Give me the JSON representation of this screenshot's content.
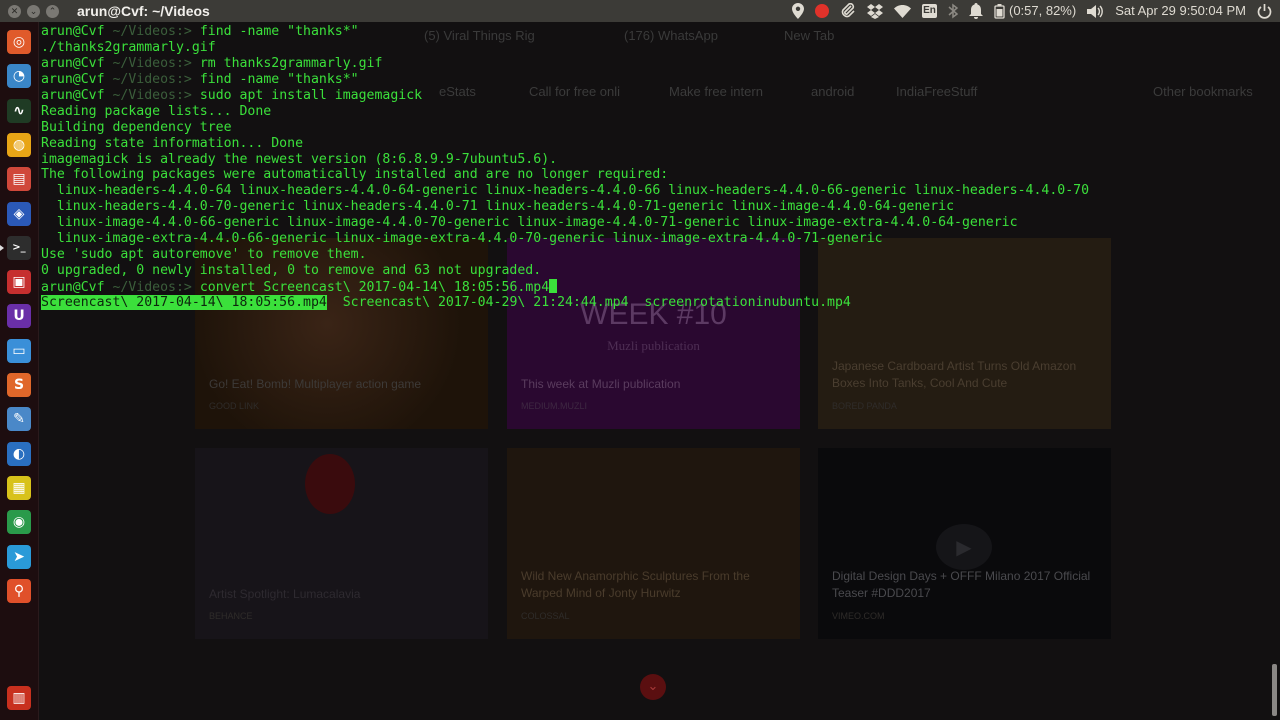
{
  "topbar": {
    "window_title": "arun@Cvf: ~/Videos",
    "battery": "(0:57, 82%)",
    "keyboard": "En",
    "datetime": "Sat Apr 29  9:50:04 PM"
  },
  "launcher": {
    "items": [
      {
        "icon": "ubuntu-dash-icon",
        "color": "#e05a2b",
        "glyph": "◎"
      },
      {
        "icon": "system-monitor-icon",
        "color": "#3a86c8",
        "glyph": "◔"
      },
      {
        "icon": "activity-monitor-icon",
        "color": "#1f3b24",
        "glyph": "∿"
      },
      {
        "icon": "idea-bulb-icon",
        "color": "#e8a516",
        "glyph": "◍"
      },
      {
        "icon": "file-manager-icon",
        "color": "#d0483a",
        "glyph": "▤"
      },
      {
        "icon": "visual-studio-code-icon",
        "color": "#2b59b8",
        "glyph": "◈"
      },
      {
        "icon": "terminal-icon",
        "color": "#2d2d2d",
        "glyph": ">_"
      },
      {
        "icon": "screen-recorder-icon",
        "color": "#c62f2f",
        "glyph": "▣"
      },
      {
        "icon": "upwork-icon",
        "color": "#6a2fa8",
        "glyph": "U"
      },
      {
        "icon": "files-icon",
        "color": "#3a8fd8",
        "glyph": "▭"
      },
      {
        "icon": "sublime-text-icon",
        "color": "#e0672a",
        "glyph": "S"
      },
      {
        "icon": "color-picker-icon",
        "color": "#4a88c8",
        "glyph": "✎"
      },
      {
        "icon": "firefox-icon",
        "color": "#2a6fc0",
        "glyph": "◐"
      },
      {
        "icon": "ruler-icon",
        "color": "#d8c21a",
        "glyph": "▦"
      },
      {
        "icon": "chrome-icon",
        "color": "#2a9a4a",
        "glyph": "◉"
      },
      {
        "icon": "telegram-icon",
        "color": "#2a9ad8",
        "glyph": "➤"
      },
      {
        "icon": "postman-icon",
        "color": "#e0502a",
        "glyph": "⚲"
      },
      {
        "icon": "trash-icon",
        "color": "#c8301e",
        "glyph": "▥"
      }
    ]
  },
  "browser": {
    "tabs": [
      "(5) Viral Things Rig",
      "(176) WhatsApp",
      "New Tab"
    ],
    "bookmarks": [
      "eStats",
      "Call for free onli",
      "Make free intern",
      "android",
      "IndiaFreeStuff",
      "Other bookmarks"
    ],
    "cards": [
      {
        "title": "Go! Eat! Bomb! Multiplayer action game",
        "source": "GOOD LINK"
      },
      {
        "title": "This week at Muzli publication",
        "source": "MEDIUM.MUZLI"
      },
      {
        "title": "Japanese Cardboard Artist Turns Old Amazon Boxes Into Tanks, Cool And Cute",
        "source": "BORED PANDA"
      },
      {
        "title": "Artist Spotlight: Lumacalavia",
        "source": "BEHANCE"
      },
      {
        "title": "Wild New Anamorphic Sculptures From the Warped Mind of Jonty Hurwitz",
        "source": "COLOSSAL"
      },
      {
        "title": "Digital Design Days + OFFF Milano 2017 Official Teaser #DDD2017",
        "source": "VIMEO.COM"
      }
    ],
    "banner_text": "WEEK #10",
    "banner_sub": "Muzli publication"
  },
  "terminal": {
    "prompt_user": "arun@Cvf",
    "prompt_path": " ~/Videos:> ",
    "lines": [
      {
        "type": "prompt",
        "cmd": "find -name \"thanks*\""
      },
      {
        "type": "out",
        "text": "./thanks2grammarly.gif"
      },
      {
        "type": "prompt",
        "cmd": "rm thanks2grammarly.gif"
      },
      {
        "type": "prompt",
        "cmd": "find -name \"thanks*\""
      },
      {
        "type": "prompt",
        "cmd": "sudo apt install imagemagick"
      },
      {
        "type": "out",
        "text": "Reading package lists... Done"
      },
      {
        "type": "out",
        "text": "Building dependency tree"
      },
      {
        "type": "out",
        "text": "Reading state information... Done"
      },
      {
        "type": "out",
        "text": "imagemagick is already the newest version (8:6.8.9.9-7ubuntu5.6)."
      },
      {
        "type": "out",
        "text": "The following packages were automatically installed and are no longer required:"
      },
      {
        "type": "out",
        "text": "  linux-headers-4.4.0-64 linux-headers-4.4.0-64-generic linux-headers-4.4.0-66 linux-headers-4.4.0-66-generic linux-headers-4.4.0-70"
      },
      {
        "type": "out",
        "text": "  linux-headers-4.4.0-70-generic linux-headers-4.4.0-71 linux-headers-4.4.0-71-generic linux-image-4.4.0-64-generic"
      },
      {
        "type": "out",
        "text": "  linux-image-4.4.0-66-generic linux-image-4.4.0-70-generic linux-image-4.4.0-71-generic linux-image-extra-4.4.0-64-generic"
      },
      {
        "type": "out",
        "text": "  linux-image-extra-4.4.0-66-generic linux-image-extra-4.4.0-70-generic linux-image-extra-4.4.0-71-generic"
      },
      {
        "type": "out",
        "text": "Use 'sudo apt autoremove' to remove them."
      },
      {
        "type": "out",
        "text": "0 upgraded, 0 newly installed, 0 to remove and 63 not upgraded."
      },
      {
        "type": "prompt",
        "cmd": "convert Screencast\\ 2017-04-14\\ 18:05:56.mp4",
        "cursor": true
      }
    ],
    "completions": {
      "selected": "Screencast\\ 2017-04-14\\ 18:05:56.mp4",
      "others": [
        "Screencast\\ 2017-04-29\\ 21:24:44.mp4",
        "screenrotationinubuntu.mp4"
      ]
    }
  }
}
